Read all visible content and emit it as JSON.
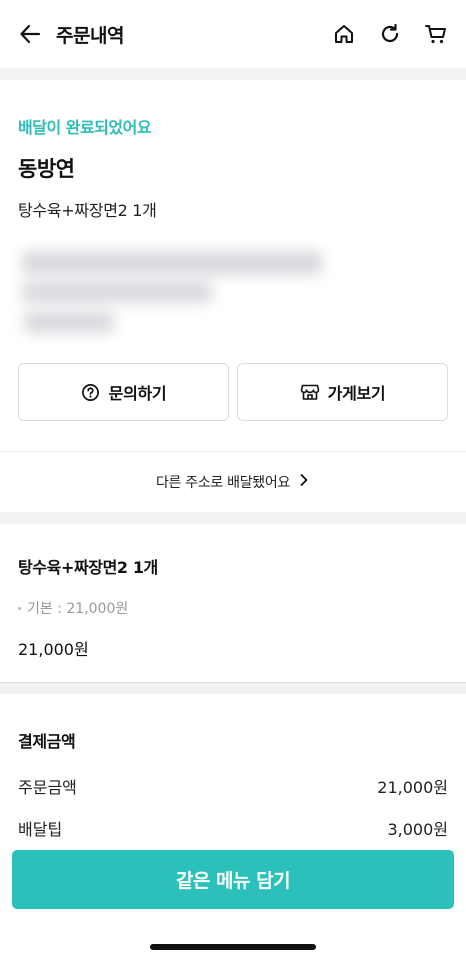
{
  "header": {
    "title": "주문내역"
  },
  "status": {
    "message": "배달이 완료되었어요",
    "store_name": "동방연",
    "order_summary": "탕수육+짜장면2 1개"
  },
  "buttons": {
    "inquiry_label": "문의하기",
    "store_label": "가게보기"
  },
  "address_link": {
    "label": "다른 주소로 배달됐어요"
  },
  "menu": {
    "title": "탕수육+짜장면2 1개",
    "option": "기본 : 21,000원",
    "price": "21,000원"
  },
  "payment": {
    "title": "결제금액",
    "rows": [
      {
        "label": "주문금액",
        "value": "21,000원"
      },
      {
        "label": "배달팁",
        "value": "3,000원"
      }
    ]
  },
  "cta": {
    "label": "같은 메뉴 담기"
  },
  "colors": {
    "accent": "#2dbdb7",
    "cta_background": "#2cc0bb"
  }
}
